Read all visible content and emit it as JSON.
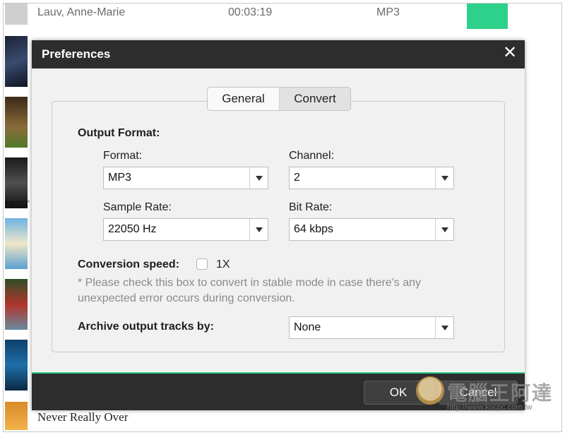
{
  "background": {
    "track": {
      "artist": "Lauv, Anne-Marie",
      "duration": "00:03:19",
      "format": "MP3"
    },
    "thumb_text": "MENT",
    "bottom_track_title": "Never Really Over"
  },
  "dialog": {
    "title": "Preferences",
    "close_icon": "✕",
    "tabs": [
      {
        "label": "General"
      },
      {
        "label": "Convert"
      }
    ],
    "output_format_label": "Output Format:",
    "format": {
      "label": "Format:",
      "value": "MP3"
    },
    "channel": {
      "label": "Channel:",
      "value": "2"
    },
    "sample_rate": {
      "label": "Sample Rate:",
      "value": "22050 Hz"
    },
    "bit_rate": {
      "label": "Bit Rate:",
      "value": "64 kbps"
    },
    "conversion_speed": {
      "label": "Conversion speed:",
      "option": "1X",
      "checked": false
    },
    "note": "* Please check this box to convert in stable mode in case there's any unexpected error occurs during conversion.",
    "archive": {
      "label": "Archive output tracks by:",
      "value": "None"
    },
    "ok_label": "OK",
    "cancel_label": "Cancel"
  },
  "watermark": {
    "text": "電腦王阿達",
    "url": "http://www.kocpc.com.tw"
  },
  "colors": {
    "accent": "#2ed18a",
    "header": "#2d2d2d",
    "panel": "#f1f1f1"
  }
}
